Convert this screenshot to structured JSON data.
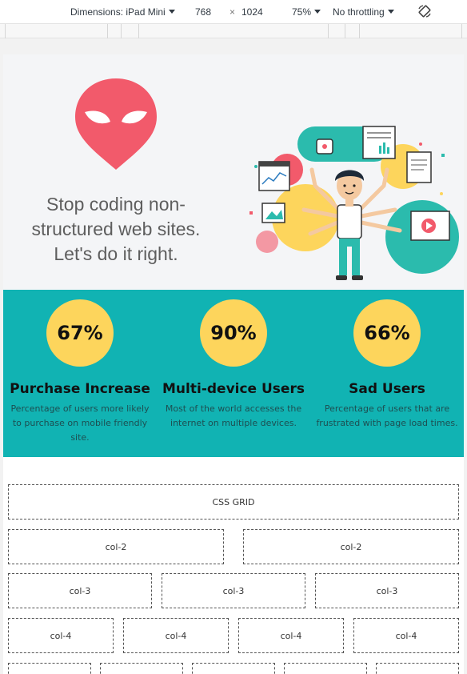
{
  "devtools": {
    "dimensions_label": "Dimensions: iPad Mini",
    "width": "768",
    "times": "×",
    "height": "1024",
    "zoom": "75%",
    "throttling": "No throttling"
  },
  "hero": {
    "tagline": "Stop coding non-structured web sites. Let's do it right."
  },
  "stats": [
    {
      "value": "67%",
      "title": "Purchase Increase",
      "description": "Percentage of users more likely to purchase on mobile friendly site."
    },
    {
      "value": "90%",
      "title": "Multi-device Users",
      "description": "Most of the world accesses the internet on multiple devices."
    },
    {
      "value": "66%",
      "title": "Sad Users",
      "description": "Percentage of users that are frustrated with page load times."
    }
  ],
  "grid": {
    "header": "CSS GRID",
    "col2": [
      "col-2",
      "col-2"
    ],
    "col3": [
      "col-3",
      "col-3",
      "col-3"
    ],
    "col4": [
      "col-4",
      "col-4",
      "col-4",
      "col-4"
    ]
  },
  "colors": {
    "brand_red": "#f25a6b",
    "teal": "#11b3b3",
    "yellow": "#fdd55c"
  }
}
